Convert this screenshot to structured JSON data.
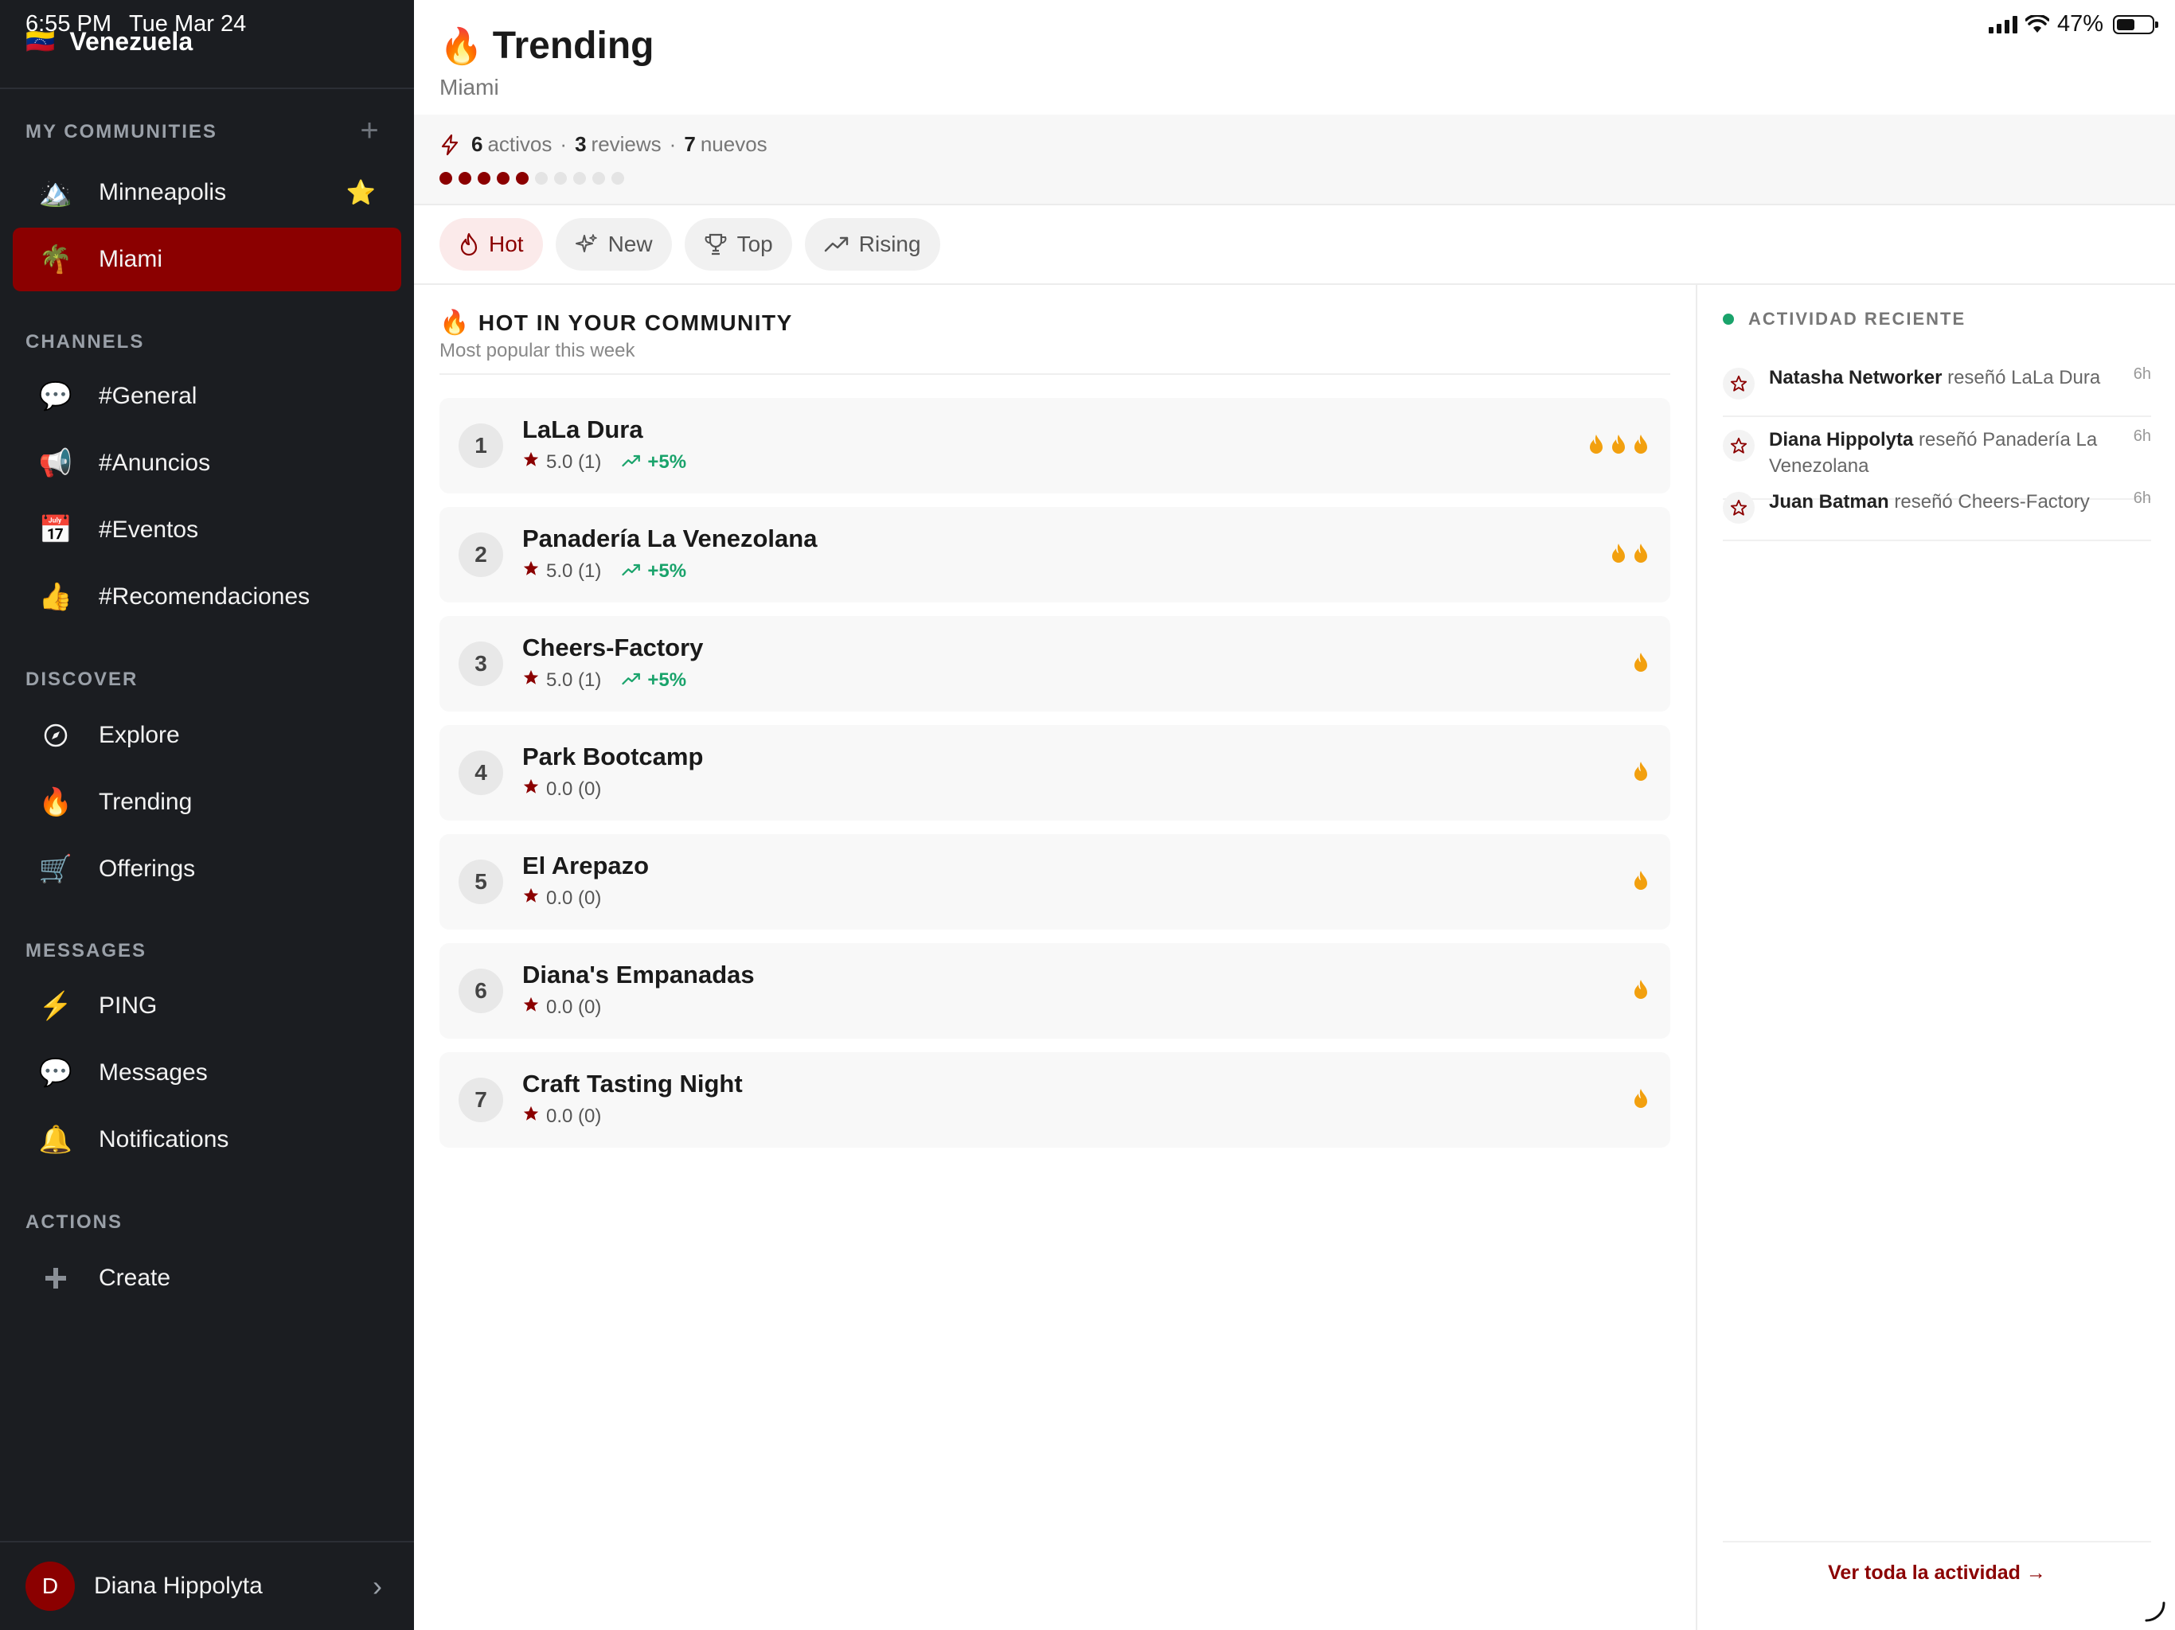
{
  "status": {
    "time": "6:55 PM",
    "date": "Tue Mar 24",
    "battery": "47%"
  },
  "sidebar": {
    "workspace_flag": "🇻🇪",
    "workspace_name": "Venezuela",
    "my_communities_label": "MY COMMUNITIES",
    "communities": [
      {
        "icon": "🏔️",
        "label": "Minneapolis",
        "favorite": "⭐"
      },
      {
        "icon": "🌴",
        "label": "Miami"
      }
    ],
    "channels_label": "CHANNELS",
    "channels": [
      {
        "icon": "💬",
        "label": "#General"
      },
      {
        "icon": "📢",
        "label": "#Anuncios"
      },
      {
        "icon": "📅",
        "label": "#Eventos"
      },
      {
        "icon": "👍",
        "label": "#Recomendaciones"
      }
    ],
    "discover_label": "DISCOVER",
    "discover": [
      {
        "icon": "🧭",
        "label": "Explore"
      },
      {
        "icon": "🔥",
        "label": "Trending"
      },
      {
        "icon": "🛒",
        "label": "Offerings"
      }
    ],
    "messages_label": "MESSAGES",
    "messages": [
      {
        "icon": "⚡",
        "label": "PING"
      },
      {
        "icon": "💬",
        "label": "Messages"
      },
      {
        "icon": "🔔",
        "label": "Notifications"
      }
    ],
    "actions_label": "ACTIONS",
    "actions": [
      {
        "icon": "➕",
        "label": "Create"
      }
    ],
    "user": {
      "initial": "D",
      "name": "Diana Hippolyta"
    }
  },
  "header": {
    "title_icon": "🔥",
    "title": "Trending",
    "subtitle": "Miami"
  },
  "stats": {
    "active_count": "6",
    "active_label": "activos",
    "reviews_count": "3",
    "reviews_label": "reviews",
    "new_count": "7",
    "new_label": "nuevos",
    "sep": "·",
    "activity_level": 5,
    "activity_max": 10
  },
  "tabs": [
    {
      "label": "Hot",
      "icon": "flame-icon",
      "active": true
    },
    {
      "label": "New",
      "icon": "sparkles-icon",
      "active": false
    },
    {
      "label": "Top",
      "icon": "trophy-icon",
      "active": false
    },
    {
      "label": "Rising",
      "icon": "trending-up-icon",
      "active": false
    }
  ],
  "feed": {
    "title_icon": "🔥",
    "title": "HOT IN YOUR COMMUNITY",
    "subtitle": "Most popular this week",
    "items": [
      {
        "rank": "1",
        "name": "LaLa Dura",
        "rating": "5.0 (1)",
        "trend": "+5%",
        "flames": 3
      },
      {
        "rank": "2",
        "name": "Panadería La Venezolana",
        "rating": "5.0 (1)",
        "trend": "+5%",
        "flames": 2
      },
      {
        "rank": "3",
        "name": "Cheers-Factory",
        "rating": "5.0 (1)",
        "trend": "+5%",
        "flames": 1
      },
      {
        "rank": "4",
        "name": "Park Bootcamp",
        "rating": "0.0 (0)",
        "trend": "",
        "flames": 1
      },
      {
        "rank": "5",
        "name": "El Arepazo",
        "rating": "0.0 (0)",
        "trend": "",
        "flames": 1
      },
      {
        "rank": "6",
        "name": "Diana's Empanadas",
        "rating": "0.0 (0)",
        "trend": "",
        "flames": 1
      },
      {
        "rank": "7",
        "name": "Craft Tasting Night",
        "rating": "0.0 (0)",
        "trend": "",
        "flames": 1
      }
    ]
  },
  "activity": {
    "title": "ACTIVIDAD RECIENTE",
    "items": [
      {
        "who": "Natasha Networker",
        "text": "reseñó LaLa Dura",
        "time": "6h"
      },
      {
        "who": "Diana Hippolyta",
        "text": "reseñó Panadería La Venezolana",
        "time": "6h"
      },
      {
        "who": "Juan Batman",
        "text": "reseñó Cheers-Factory",
        "time": "6h"
      }
    ],
    "footer": "Ver toda la actividad →"
  },
  "colors": {
    "accent": "#8b0000",
    "sidebar_bg": "#1b1d21",
    "positive": "#1aa36b",
    "flame": "#f2a00f"
  }
}
